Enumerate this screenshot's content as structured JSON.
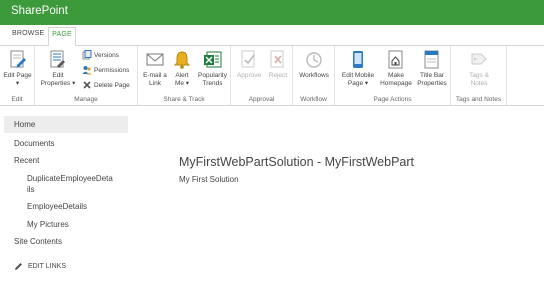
{
  "suite_bar": {
    "brand": "SharePoint"
  },
  "ribbon": {
    "tabs": [
      {
        "label": "BROWSE"
      },
      {
        "label": "PAGE"
      }
    ],
    "groups": {
      "edit": {
        "label": "Edit",
        "edit_page": [
          "Edit Page",
          "▾"
        ]
      },
      "manage": {
        "label": "Manage",
        "edit_properties": [
          "Edit",
          "Properties ▾"
        ],
        "versions": "Versions",
        "permissions": "Permissions",
        "delete_page": "Delete Page"
      },
      "share_track": {
        "label": "Share & Track",
        "email_link": [
          "E-mail a",
          "Link"
        ],
        "alert_me": [
          "Alert",
          "Me ▾"
        ],
        "popularity_trends": [
          "Popularity",
          "Trends"
        ]
      },
      "approval": {
        "label": "Approval",
        "approve": "Approve",
        "reject": "Reject"
      },
      "workflow": {
        "label": "Workflow",
        "workflows": "Workflows"
      },
      "page_actions": {
        "label": "Page Actions",
        "edit_mobile_page": [
          "Edit Mobile",
          "Page ▾"
        ],
        "make_homepage": [
          "Make",
          "Homepage"
        ],
        "title_bar_properties": [
          "Title Bar",
          "Properties"
        ]
      },
      "tags_notes": {
        "label": "Tags and Notes",
        "tags_notes_btn": [
          "Tags &",
          "Notes"
        ]
      }
    }
  },
  "nav": {
    "home": "Home",
    "documents": "Documents",
    "recent": "Recent",
    "recent_items": [
      [
        "DuplicateEmployeeDeta",
        "ils"
      ],
      "EmployeeDetails",
      "My Pictures"
    ],
    "site_contents": "Site Contents",
    "edit_links": "EDIT LINKS"
  },
  "main": {
    "title": "MyFirstWebPartSolution - MyFirstWebPart",
    "subtitle": "My First Solution"
  },
  "colors": {
    "brand_green": "#3d9a3a",
    "accent_blue": "#2a7ac3",
    "text": "#444444",
    "disabled": "#b0b0b0"
  }
}
